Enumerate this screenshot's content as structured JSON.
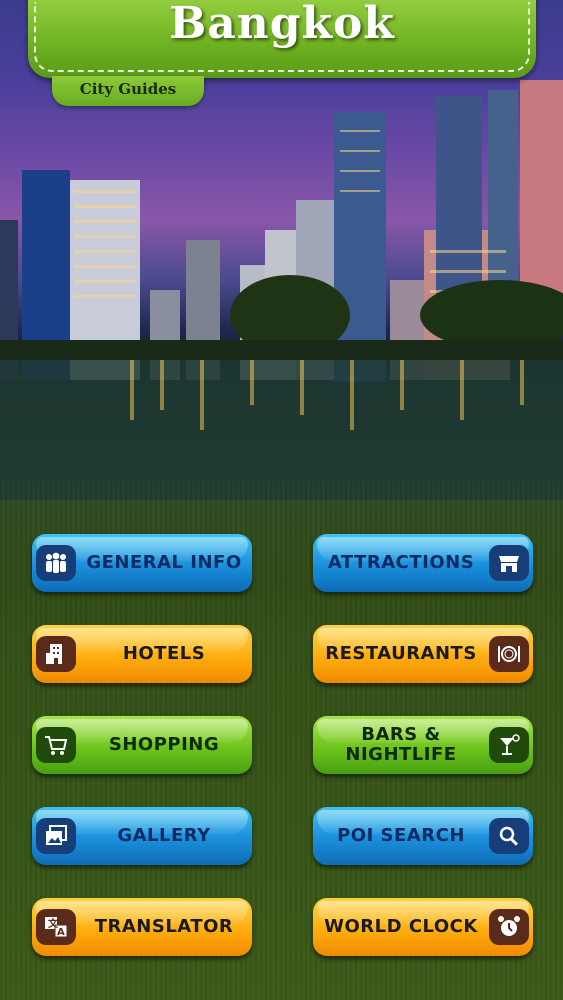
{
  "header": {
    "title": "Bangkok",
    "subtitle": "City Guides"
  },
  "menu": {
    "general_info": "GENERAL INFO",
    "attractions": "ATTRACTIONS",
    "hotels": "HOTELS",
    "restaurants": "RESTAURANTS",
    "shopping": "SHOPPING",
    "bars_nightlife_line1": "BARS &",
    "bars_nightlife_line2": "NIGHTLIFE",
    "gallery": "GALLERY",
    "poi_search": "POI SEARCH",
    "translator": "TRANSLATOR",
    "world_clock": "WORLD CLOCK"
  },
  "colors": {
    "banner_green": "#6fb222",
    "button_blue": "#1a8fdc",
    "button_orange": "#ffae10",
    "button_green": "#6ec41c"
  },
  "icons": {
    "general_info": "people-group-icon",
    "attractions": "storefront-icon",
    "hotels": "hotel-building-icon",
    "restaurants": "plate-cutlery-icon",
    "shopping": "shopping-cart-icon",
    "bars_nightlife": "cocktail-glass-icon",
    "gallery": "photos-icon",
    "poi_search": "magnifier-icon",
    "translator": "translate-icon",
    "world_clock": "alarm-clock-icon"
  }
}
